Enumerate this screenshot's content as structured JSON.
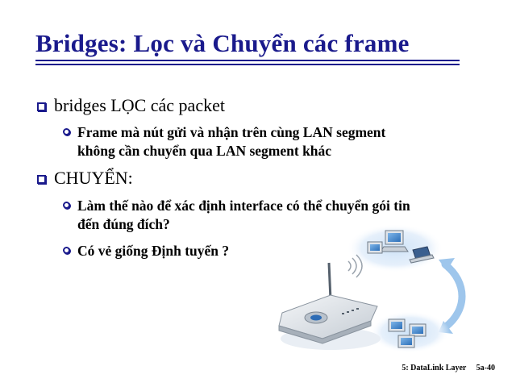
{
  "slide": {
    "title": "Bridges: Lọc và Chuyển các frame",
    "bullets": [
      {
        "text": "bridges LỌC các packet",
        "sub": [
          {
            "line1": "Frame mà nút gửi và nhận trên cùng LAN segment",
            "line2": "không cần chuyển qua LAN segment khác"
          }
        ]
      },
      {
        "text": "CHUYỂN:",
        "sub": [
          {
            "line1": "Làm thế nào để xác định interface có thể chuyển gói tin",
            "line2": "đến đúng đích?"
          },
          {
            "line1": "Có vẻ giống Định tuyến ?",
            "line2": ""
          }
        ]
      }
    ]
  },
  "footer": {
    "chapter": "5: DataLink Layer",
    "page": "5a-40"
  },
  "colors": {
    "title": "#1a1a8c",
    "bullet": "#1a1a8c",
    "arrow": "#9ec6ec"
  },
  "icons": {
    "diagram": "network-bridge-illustration"
  }
}
